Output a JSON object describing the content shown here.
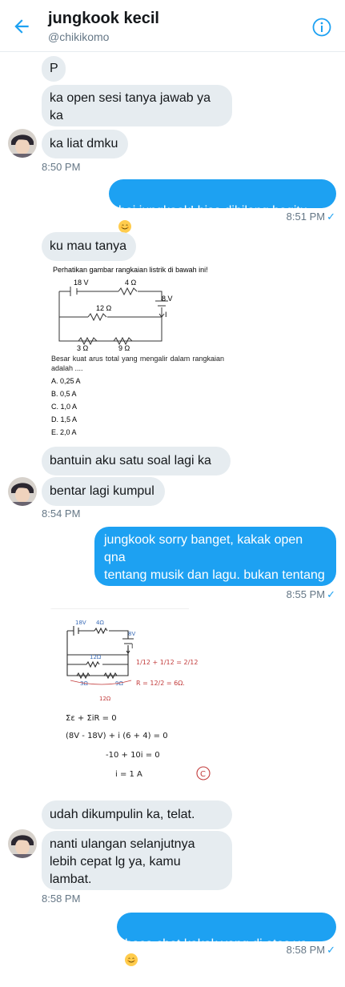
{
  "header": {
    "title": "jungkook kecil",
    "handle": "@chikikomo"
  },
  "messages": [
    {
      "text": "P"
    },
    {
      "text": "ka open sesi tanya jawab ya\nka"
    },
    {
      "text": "ka liat dmku"
    },
    {
      "time": "8:50 PM"
    },
    {
      "text": "hai jungkook! bisa dibilang begitu"
    },
    {
      "time": "8:51 PM"
    },
    {
      "text": "ku mau tanya"
    },
    {
      "text": "bantuin aku satu soal lagi ka"
    },
    {
      "text": "bentar lagi kumpul"
    },
    {
      "time": "8:54 PM"
    },
    {
      "text": "jungkook sorry banget, kakak open qna\ntentang musik dan lagu. bukan tentang\nfisika (?) yaa.."
    },
    {
      "time": "8:55 PM"
    },
    {
      "text": "udah dikumpulin ka, telat."
    },
    {
      "text": "nanti ulangan selanjutnya\nlebih cepat lg ya, kamu\nlambat."
    },
    {
      "time": "8:58 PM"
    },
    {
      "text": "baca chat kakak yang di atas ya"
    },
    {
      "time": "8:58 PM"
    }
  ],
  "question_image": {
    "prompt": "Perhatikan gambar rangkaian listrik di bawah ini!",
    "labels": [
      "18 V",
      "4 Ω",
      "8 V",
      "12 Ω",
      "I",
      "3 Ω",
      "9 Ω"
    ],
    "question": "Besar kuat arus total yang mengalir dalam rangkaian adalah ....",
    "options": [
      "A.  0,25 A",
      "B.  0,5 A",
      "C.  1,0 A",
      "D.  1,5 A",
      "E.  2,0 A"
    ]
  },
  "answer_image": {
    "labels": [
      "18V",
      "4Ω",
      "8V",
      "12Ω",
      "I",
      "3Ω",
      "9Ω",
      "12Ω"
    ],
    "lines": [
      "1/12 + 1/12 = 2/12",
      "R = 12/2 = 6Ω.",
      "Σε + ΣiR = 0",
      "(8V - 18V) + i (6 + 4) = 0",
      "-10 + 10i = 0",
      "i = 1 A",
      "C"
    ]
  },
  "colors": {
    "accent": "#1da1f2",
    "incoming": "#e6ecf0",
    "muted": "#657786"
  },
  "icons": [
    "back-arrow-icon",
    "info-icon",
    "checkmark-icon",
    "smiling-face-emoji"
  ]
}
